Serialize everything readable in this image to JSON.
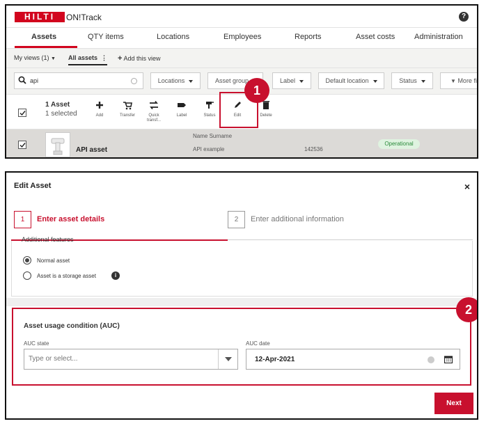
{
  "header": {
    "logo_text": "HILTI",
    "app_name": "ON!Track",
    "help_glyph": "?"
  },
  "tabs": [
    "Assets",
    "QTY items",
    "Locations",
    "Employees",
    "Reports",
    "Asset costs",
    "Administration"
  ],
  "views": {
    "my_views": "My views (1)",
    "all_assets": "All assets",
    "add_view": "Add this view"
  },
  "filters": {
    "search_value": "api",
    "buttons": [
      "Locations",
      "Asset group",
      "Label",
      "Default location",
      "Status",
      "More fil"
    ]
  },
  "toolbar": {
    "asset_count": "1 Asset",
    "selected": "1 selected",
    "items": [
      "Add",
      "Transfer",
      "Quick transf...",
      "Label",
      "Status",
      "Edit",
      "Delete"
    ]
  },
  "asset_row": {
    "name": "API asset",
    "owner": "Name Surname",
    "description": "API example",
    "number": "142536",
    "status": "Operational"
  },
  "callouts": [
    "1",
    "2"
  ],
  "dialog": {
    "title": "Edit Asset",
    "close_glyph": "×",
    "steps": [
      {
        "num": "1",
        "label": "Enter asset details"
      },
      {
        "num": "2",
        "label": "Enter additional information"
      }
    ],
    "features_title": "Additional features",
    "radio_options": [
      "Normal asset",
      "Asset is a storage asset"
    ],
    "info_glyph": "i",
    "auc": {
      "title": "Asset usage condition (AUC)",
      "state_label": "AUC state",
      "state_placeholder": "Type or select...",
      "date_label": "AUC date",
      "date_value": "12-Apr-2021"
    },
    "next_label": "Next"
  },
  "colors": {
    "brand_red": "#d2051e",
    "highlight_red": "#c8102e",
    "status_green": "#2a8a3a"
  }
}
